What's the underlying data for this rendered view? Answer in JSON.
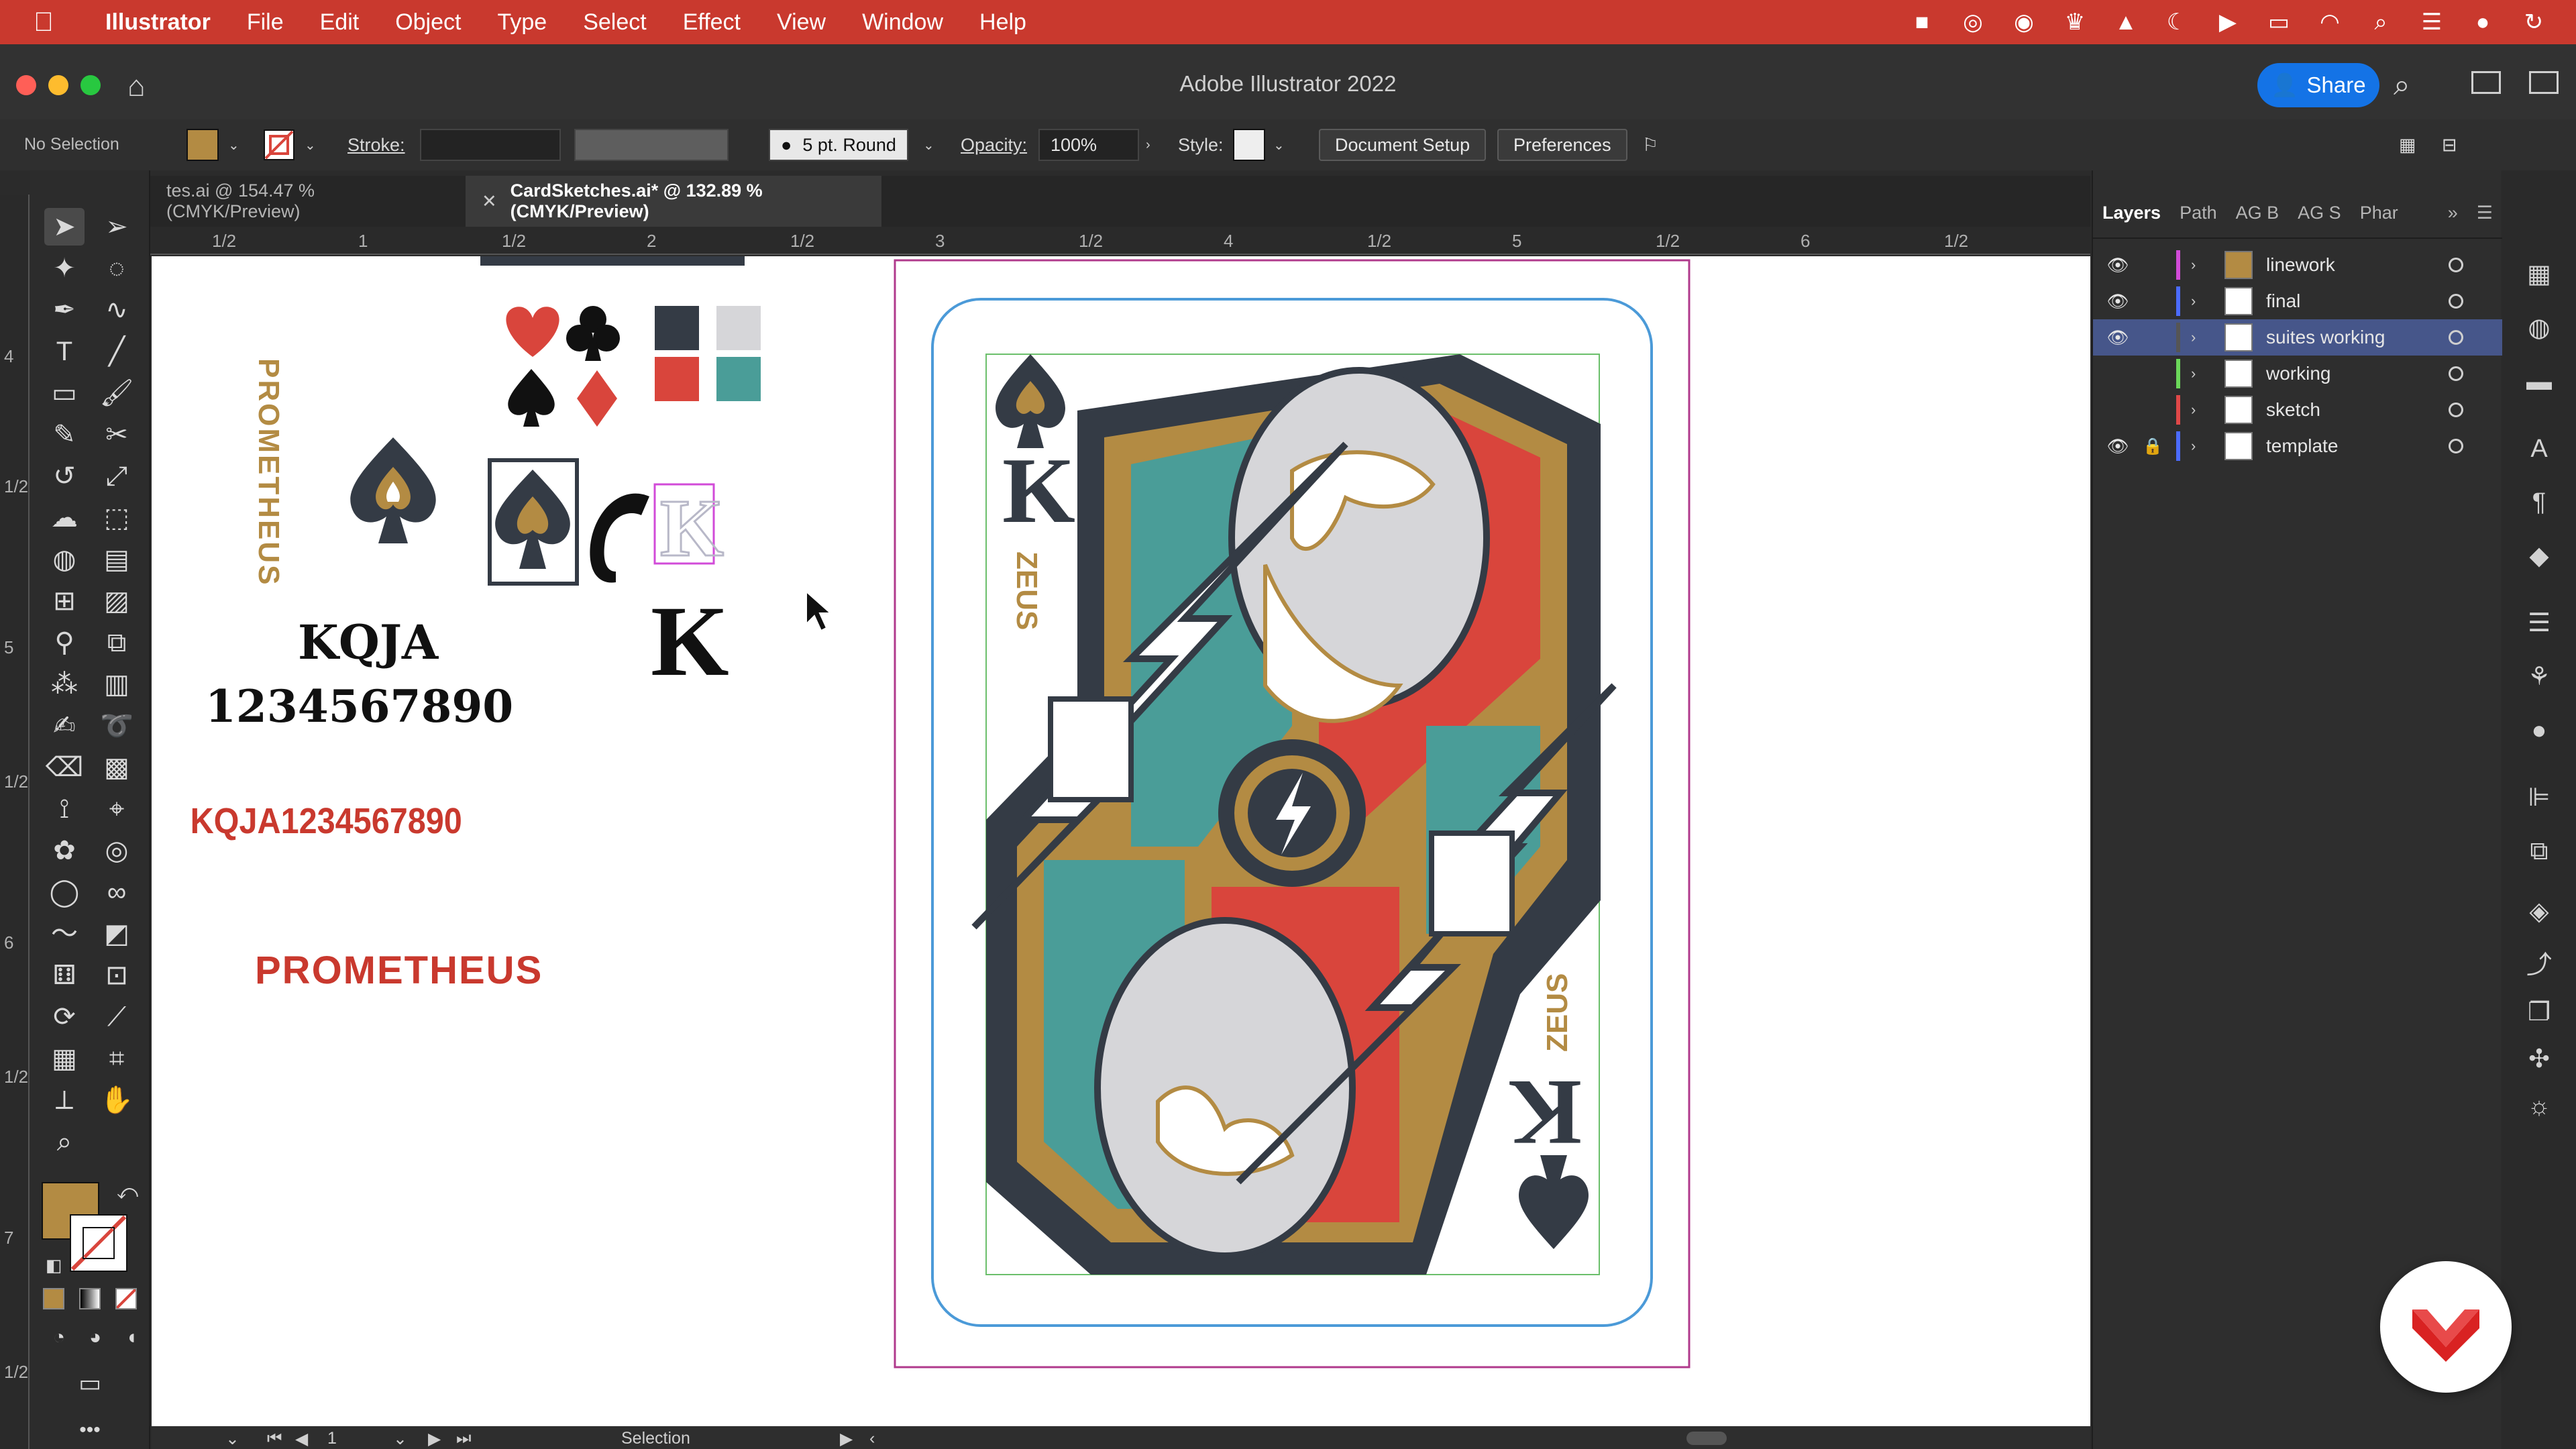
{
  "menubar": {
    "apple": "",
    "items": [
      "Illustrator",
      "File",
      "Edit",
      "Object",
      "Type",
      "Select",
      "Effect",
      "View",
      "Window",
      "Help"
    ]
  },
  "titlebar": {
    "title": "Adobe Illustrator 2022",
    "share": "Share"
  },
  "controlbar": {
    "selection": "No Selection",
    "stroke_label": "Stroke:",
    "brush": "5 pt. Round",
    "opacity_label": "Opacity:",
    "opacity": "100%",
    "style_label": "Style:",
    "document_setup": "Document Setup",
    "preferences": "Preferences"
  },
  "tabs": [
    {
      "label": "tes.ai @ 154.47 % (CMYK/Preview)"
    },
    {
      "label": "CardSketches.ai* @ 132.89 % (CMYK/Preview)"
    }
  ],
  "ruler_top": [
    "1/2",
    "1",
    "1/2",
    "2",
    "1/2",
    "3",
    "1/2",
    "4",
    "1/2",
    "5",
    "1/2",
    "6",
    "1/2"
  ],
  "ruler_left": [
    "4",
    "1/2",
    "5",
    "1/2",
    "6",
    "1/2",
    "7",
    "1/2"
  ],
  "canvas": {
    "prometheus_vertical": "PROMETHEUS",
    "kqja": "KQJA",
    "digits": "1234567890",
    "red_line": "KQJA1234567890",
    "prometheus_red": "PROMETHEUS",
    "big_k": "K",
    "corner_k": "K",
    "card_name": "ZEUS"
  },
  "colors": {
    "gold": "#b38b43",
    "red": "#d9453c",
    "navy": "#343b45",
    "teal": "#4a9d98",
    "grey": "#d6d6d9"
  },
  "layers": {
    "tabs": [
      "Layers",
      "Path",
      "AG B",
      "AG S",
      "Phar"
    ],
    "rows": [
      {
        "name": "linework",
        "color": "#d24bd8",
        "visible": true,
        "locked": false,
        "selected": false
      },
      {
        "name": "final",
        "color": "#4b6bff",
        "visible": true,
        "locked": false,
        "selected": false
      },
      {
        "name": "suites working",
        "color": "#555555",
        "visible": true,
        "locked": false,
        "selected": true
      },
      {
        "name": "working",
        "color": "#6bd85a",
        "visible": false,
        "locked": false,
        "selected": false
      },
      {
        "name": "sketch",
        "color": "#e04848",
        "visible": false,
        "locked": false,
        "selected": false
      },
      {
        "name": "template",
        "color": "#4b6bff",
        "visible": true,
        "locked": true,
        "selected": false
      }
    ]
  },
  "statusbar": {
    "page": "1",
    "tool": "Selection"
  }
}
